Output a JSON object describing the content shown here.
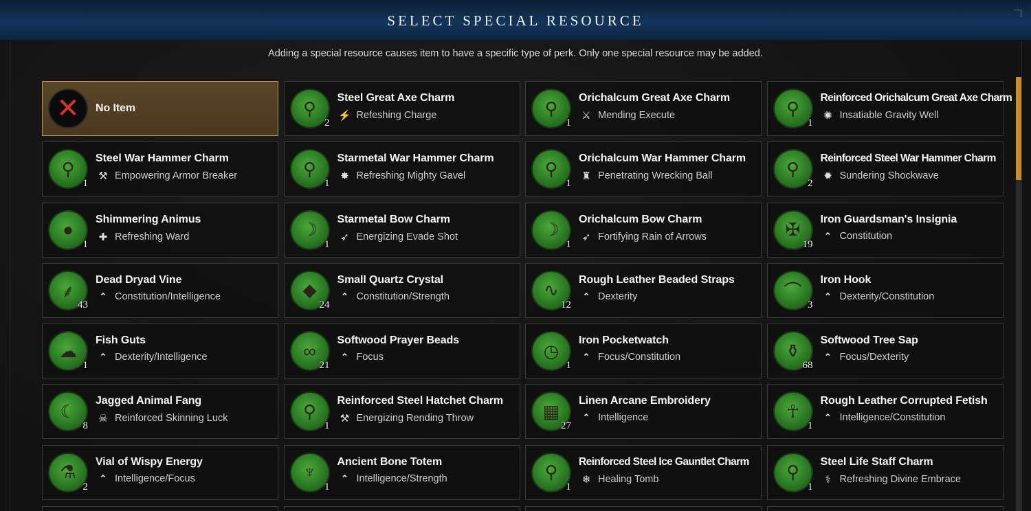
{
  "header": {
    "title": "SELECT SPECIAL RESOURCE"
  },
  "description": "Adding a special resource causes item to have a specific type of perk. Only one special resource may be added.",
  "accent_color": "#c98d2a",
  "items": [
    {
      "name": "No Item",
      "perk": "",
      "qty": "",
      "icon": "close-x-icon",
      "perk_icon": "",
      "selected": true
    },
    {
      "name": "Steel Great Axe Charm",
      "perk": "Refeshing Charge",
      "qty": "2",
      "icon": "axe-charm-icon",
      "perk_icon": "charge-icon"
    },
    {
      "name": "Orichalcum Great Axe Charm",
      "perk": "Mending Execute",
      "qty": "1",
      "icon": "axe-charm-icon",
      "perk_icon": "execute-icon"
    },
    {
      "name": "Reinforced Orichalcum Great Axe Charm",
      "perk": "Insatiable Gravity Well",
      "qty": "1",
      "icon": "axe-charm-icon",
      "perk_icon": "gravity-well-icon"
    },
    {
      "name": "Steel War Hammer Charm",
      "perk": "Empowering Armor Breaker",
      "qty": "1",
      "icon": "hammer-charm-icon",
      "perk_icon": "armor-breaker-icon"
    },
    {
      "name": "Starmetal War Hammer Charm",
      "perk": "Refreshing Mighty Gavel",
      "qty": "1",
      "icon": "hammer-charm-icon",
      "perk_icon": "gavel-icon"
    },
    {
      "name": "Orichalcum War Hammer Charm",
      "perk": "Penetrating Wrecking Ball",
      "qty": "1",
      "icon": "hammer-charm-icon",
      "perk_icon": "wrecking-ball-icon"
    },
    {
      "name": "Reinforced Steel War Hammer Charm",
      "perk": "Sundering Shockwave",
      "qty": "2",
      "icon": "hammer-charm-icon",
      "perk_icon": "shockwave-icon"
    },
    {
      "name": "Shimmering Animus",
      "perk": "Refreshing Ward",
      "qty": "1",
      "icon": "animus-orb-icon",
      "perk_icon": "ward-icon"
    },
    {
      "name": "Starmetal Bow Charm",
      "perk": "Energizing Evade Shot",
      "qty": "1",
      "icon": "bow-charm-icon",
      "perk_icon": "bow-shot-icon"
    },
    {
      "name": "Orichalcum Bow Charm",
      "perk": "Fortifying Rain of Arrows",
      "qty": "1",
      "icon": "bow-charm-icon",
      "perk_icon": "bow-shot-icon"
    },
    {
      "name": "Iron Guardsman's Insignia",
      "perk": "Constitution",
      "qty": "19",
      "icon": "insignia-icon",
      "perk_icon": "attribute-chevron-icon"
    },
    {
      "name": "Dead Dryad Vine",
      "perk": "Constitution/Intelligence",
      "qty": "43",
      "icon": "vine-icon",
      "perk_icon": "attribute-chevron-icon"
    },
    {
      "name": "Small Quartz Crystal",
      "perk": "Constitution/Strength",
      "qty": "24",
      "icon": "crystal-icon",
      "perk_icon": "attribute-chevron-icon"
    },
    {
      "name": "Rough Leather Beaded Straps",
      "perk": "Dexterity",
      "qty": "12",
      "icon": "straps-icon",
      "perk_icon": "attribute-chevron-icon"
    },
    {
      "name": "Iron Hook",
      "perk": "Dexterity/Constitution",
      "qty": "3",
      "icon": "hook-icon",
      "perk_icon": "attribute-chevron-icon"
    },
    {
      "name": "Fish Guts",
      "perk": "Dexterity/Intelligence",
      "qty": "1",
      "icon": "fish-guts-icon",
      "perk_icon": "attribute-chevron-icon"
    },
    {
      "name": "Softwood Prayer Beads",
      "perk": "Focus",
      "qty": "21",
      "icon": "beads-icon",
      "perk_icon": "attribute-chevron-icon"
    },
    {
      "name": "Iron Pocketwatch",
      "perk": "Focus/Constitution",
      "qty": "1",
      "icon": "pocketwatch-icon",
      "perk_icon": "attribute-chevron-icon"
    },
    {
      "name": "Softwood Tree Sap",
      "perk": "Focus/Dexterity",
      "qty": "68",
      "icon": "sap-icon",
      "perk_icon": "attribute-chevron-icon"
    },
    {
      "name": "Jagged Animal Fang",
      "perk": "Reinforced Skinning Luck",
      "qty": "8",
      "icon": "fang-icon",
      "perk_icon": "skinning-icon"
    },
    {
      "name": "Reinforced Steel Hatchet Charm",
      "perk": "Energizing Rending Throw",
      "qty": "1",
      "icon": "hatchet-charm-icon",
      "perk_icon": "hatchet-throw-icon"
    },
    {
      "name": "Linen Arcane Embroidery",
      "perk": "Intelligence",
      "qty": "27",
      "icon": "embroidery-icon",
      "perk_icon": "attribute-chevron-icon"
    },
    {
      "name": "Rough Leather Corrupted Fetish",
      "perk": "Intelligence/Constitution",
      "qty": "1",
      "icon": "fetish-icon",
      "perk_icon": "attribute-chevron-icon"
    },
    {
      "name": "Vial of Wispy Energy",
      "perk": "Intelligence/Focus",
      "qty": "2",
      "icon": "vial-icon",
      "perk_icon": "attribute-chevron-icon"
    },
    {
      "name": "Ancient Bone Totem",
      "perk": "Intelligence/Strength",
      "qty": "1",
      "icon": "totem-icon",
      "perk_icon": "attribute-chevron-icon"
    },
    {
      "name": "Reinforced Steel Ice Gauntlet Charm",
      "perk": "Healing Tomb",
      "qty": "1",
      "icon": "gauntlet-charm-icon",
      "perk_icon": "ice-tomb-icon"
    },
    {
      "name": "Steel Life Staff Charm",
      "perk": "Refreshing Divine Embrace",
      "qty": "1",
      "icon": "staff-charm-icon",
      "perk_icon": "life-staff-icon"
    }
  ]
}
